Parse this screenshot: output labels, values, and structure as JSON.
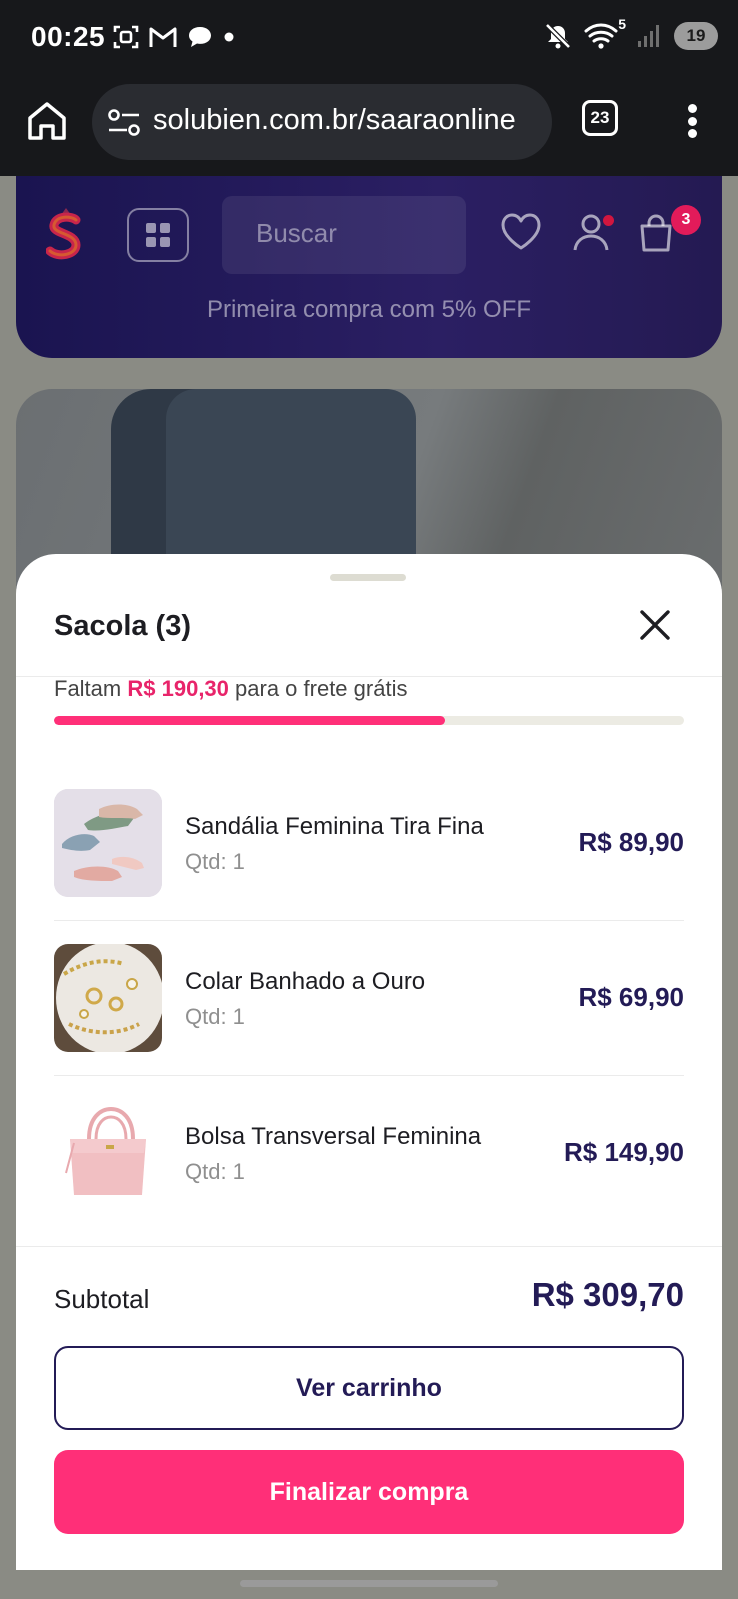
{
  "status_bar": {
    "time": "00:25",
    "left_icons": [
      "screenshot-icon",
      "gmail-icon",
      "chat-icon",
      "dot-icon"
    ],
    "right_icons": [
      "mute-icon",
      "wifi-icon",
      "signal-icon"
    ],
    "wifi_label": "5",
    "battery": "19"
  },
  "browser": {
    "url": "solubien.com.br/saaraonline",
    "tab_count": "23"
  },
  "site_header": {
    "search_placeholder": "Buscar",
    "cart_count": "3",
    "promo": "Primeira compra com 5% OFF"
  },
  "cart_sheet": {
    "title": "Sacola (3)",
    "shipping": {
      "prefix": "Faltam",
      "amount": "R$ 190,30",
      "suffix": "para o frete grátis",
      "progress_fraction": 0.62
    },
    "items": [
      {
        "name": "Sandália Feminina Tira Fina",
        "qty": "Qtd: 1",
        "price": "R$ 89,90"
      },
      {
        "name": "Colar Banhado a Ouro",
        "qty": "Qtd: 1",
        "price": "R$ 69,90"
      },
      {
        "name": "Bolsa Transversal Feminina",
        "qty": "Qtd: 1",
        "price": "R$ 149,90"
      }
    ],
    "subtotal_label": "Subtotal",
    "subtotal_value": "R$ 309,70",
    "view_cart_label": "Ver carrinho",
    "checkout_label": "Finalizar compra"
  },
  "colors": {
    "accent": "#ff2f78",
    "brand_navy": "#231b56",
    "header_bg": "#1a1450"
  }
}
